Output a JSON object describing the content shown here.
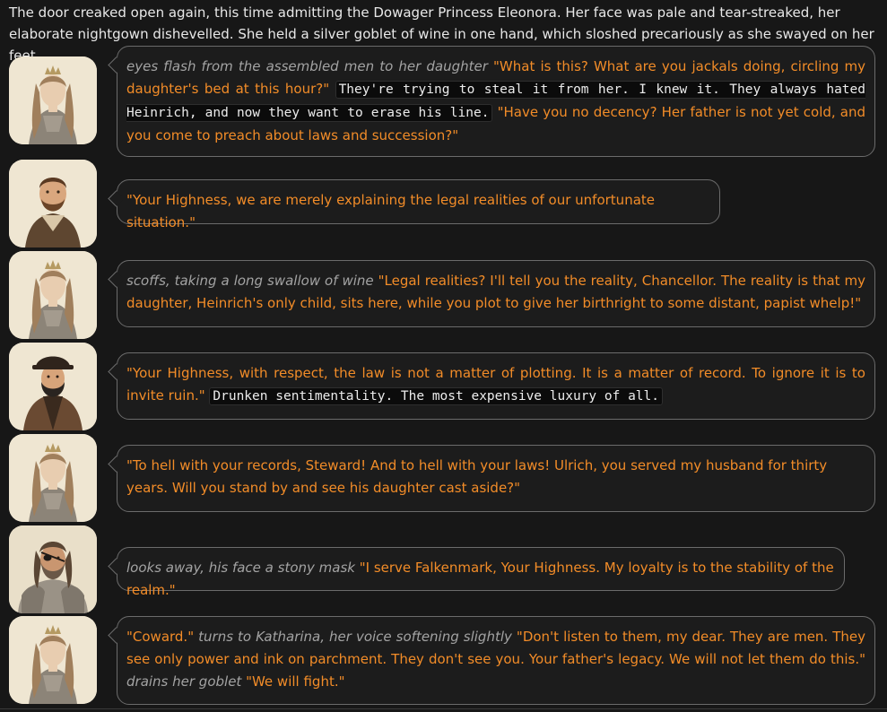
{
  "narration": "The door creaked open again, this time admitting the Dowager Princess Eleonora. Her face was pale and tear-streaked, her elaborate nightgown dishevelled. She held a silver goblet of wine in one hand, which sloshed precariously as she swayed on her feet.",
  "colors": {
    "speech": "#f28c28",
    "action": "#a3a3a3",
    "thought_bg": "#0b0b0b",
    "bubble_border": "#6b6b6b"
  },
  "messages": [
    {
      "avatar": "princess-portrait-icon",
      "segments": [
        {
          "type": "action",
          "text": "eyes flash from the assembled men to her daughter"
        },
        {
          "type": "speech",
          "text": " \"What is this? What are you jackals doing, circling my daughter's bed at this hour?\" "
        },
        {
          "type": "thought",
          "text": "They're trying to steal it from her. I knew it. They always hated Heinrich, and now they want to erase his line."
        },
        {
          "type": "speech",
          "text": " \"Have you no decency? Her father is not yet cold, and you come to preach about laws and succession?\""
        }
      ]
    },
    {
      "avatar": "chancellor-portrait-icon",
      "segments": [
        {
          "type": "speech",
          "text": "\"Your Highness, we are merely explaining the legal realities of our unfortunate situation.\""
        }
      ]
    },
    {
      "avatar": "princess-portrait-icon",
      "segments": [
        {
          "type": "action",
          "text": "scoffs, taking a long swallow of wine"
        },
        {
          "type": "speech",
          "text": " \"Legal realities? I'll tell you the reality, Chancellor. The reality is that my daughter, Heinrich's only child, sits here, while you plot to give her birthright to some distant, papist whelp!\""
        }
      ]
    },
    {
      "avatar": "steward-portrait-icon",
      "segments": [
        {
          "type": "speech",
          "text": "\"Your Highness, with respect, the law is not a matter of plotting. It is a matter of record. To ignore it is to invite ruin.\" "
        },
        {
          "type": "thought",
          "text": "Drunken sentimentality. The most expensive luxury of all."
        }
      ]
    },
    {
      "avatar": "princess-portrait-icon",
      "segments": [
        {
          "type": "speech",
          "text": "\"To hell with your records, Steward! And to hell with your laws! Ulrich, you served my husband for thirty years. Will you stand by and see his daughter cast aside?\""
        }
      ]
    },
    {
      "avatar": "knight-portrait-icon",
      "segments": [
        {
          "type": "action",
          "text": "looks away, his face a stony mask"
        },
        {
          "type": "speech",
          "text": " \"I serve Falkenmark, Your Highness. My loyalty is to the stability of the realm.\""
        }
      ]
    },
    {
      "avatar": "princess-portrait-icon",
      "segments": [
        {
          "type": "speech",
          "text": "\"Coward.\" "
        },
        {
          "type": "action",
          "text": "turns to Katharina, her voice softening slightly"
        },
        {
          "type": "speech",
          "text": " \"Don't listen to them, my dear. They are men. They see only power and ink on parchment. They don't see you. Your father's legacy. We will not let them do this.\" "
        },
        {
          "type": "action",
          "text": "drains her goblet"
        },
        {
          "type": "speech",
          "text": " \"We will fight.\""
        }
      ]
    }
  ]
}
